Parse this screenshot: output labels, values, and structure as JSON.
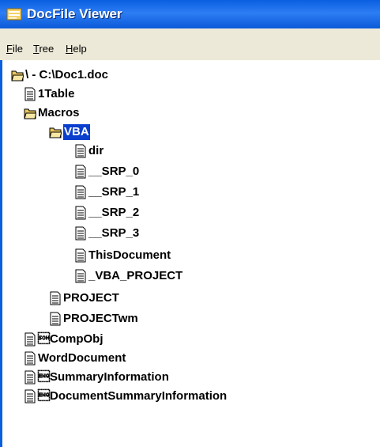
{
  "window": {
    "title": "DocFile Viewer"
  },
  "menu": [
    {
      "mnemonic": "F",
      "rest": "ile"
    },
    {
      "mnemonic": "T",
      "rest": "ree"
    },
    {
      "mnemonic": "H",
      "rest": "elp"
    }
  ],
  "tree": {
    "root": "\\ - C:\\Doc1.doc",
    "n1Table": "1Table",
    "macros": "Macros",
    "vba": "VBA",
    "dir": "dir",
    "srp0": "__SRP_0",
    "srp1": "__SRP_1",
    "srp2": "__SRP_2",
    "srp3": "__SRP_3",
    "thisDocument": "ThisDocument",
    "vbaProject": "_VBA_PROJECT",
    "project": "PROJECT",
    "projectwm": "PROJECTwm",
    "compObj": "\u0001CompObj",
    "wordDocument": "WordDocument",
    "summaryInfo": "\u0005SummaryInformation",
    "docSummaryInfo": "\u0005DocumentSummaryInformation"
  },
  "selected": "vba",
  "colors": {
    "titlebar": "#0a5fe0",
    "selection": "#0a3fce",
    "menubar": "#ece9d8"
  }
}
